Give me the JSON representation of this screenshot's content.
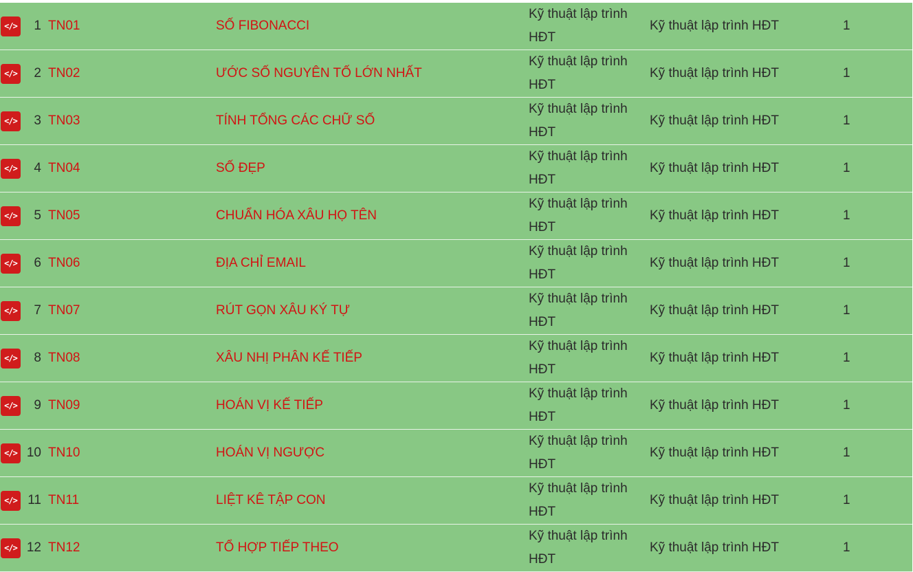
{
  "icon_name": "code-icon",
  "icon_glyph": "</>",
  "accent_color": "#d11414",
  "row_color": "#88c884",
  "rows": [
    {
      "num": "1",
      "code": "TN01",
      "title": "SỐ FIBONACCI",
      "group": "Kỹ thuật lập trình HĐT",
      "subject": "Kỹ thuật lập trình HĐT",
      "level": "1"
    },
    {
      "num": "2",
      "code": "TN02",
      "title": "ƯỚC SỐ NGUYÊN TỐ LỚN NHẤT",
      "group": "Kỹ thuật lập trình HĐT",
      "subject": "Kỹ thuật lập trình HĐT",
      "level": "1"
    },
    {
      "num": "3",
      "code": "TN03",
      "title": "TÍNH TỔNG CÁC CHỮ SỐ",
      "group": "Kỹ thuật lập trình HĐT",
      "subject": "Kỹ thuật lập trình HĐT",
      "level": "1"
    },
    {
      "num": "4",
      "code": "TN04",
      "title": "SỐ ĐẸP",
      "group": "Kỹ thuật lập trình HĐT",
      "subject": "Kỹ thuật lập trình HĐT",
      "level": "1"
    },
    {
      "num": "5",
      "code": "TN05",
      "title": "CHUẨN HÓA XÂU HỌ TÊN",
      "group": "Kỹ thuật lập trình HĐT",
      "subject": "Kỹ thuật lập trình HĐT",
      "level": "1"
    },
    {
      "num": "6",
      "code": "TN06",
      "title": "ĐỊA CHỈ EMAIL",
      "group": "Kỹ thuật lập trình HĐT",
      "subject": "Kỹ thuật lập trình HĐT",
      "level": "1"
    },
    {
      "num": "7",
      "code": "TN07",
      "title": "RÚT GỌN XÂU KÝ TỰ",
      "group": "Kỹ thuật lập trình HĐT",
      "subject": "Kỹ thuật lập trình HĐT",
      "level": "1"
    },
    {
      "num": "8",
      "code": "TN08",
      "title": "XÂU NHỊ PHÂN KẾ TIẾP",
      "group": "Kỹ thuật lập trình HĐT",
      "subject": "Kỹ thuật lập trình HĐT",
      "level": "1"
    },
    {
      "num": "9",
      "code": "TN09",
      "title": "HOÁN VỊ KẾ TIẾP",
      "group": "Kỹ thuật lập trình HĐT",
      "subject": "Kỹ thuật lập trình HĐT",
      "level": "1"
    },
    {
      "num": "10",
      "code": "TN10",
      "title": "HOÁN VỊ NGƯỢC",
      "group": "Kỹ thuật lập trình HĐT",
      "subject": "Kỹ thuật lập trình HĐT",
      "level": "1"
    },
    {
      "num": "11",
      "code": "TN11",
      "title": "LIỆT KÊ TẬP CON",
      "group": "Kỹ thuật lập trình HĐT",
      "subject": "Kỹ thuật lập trình HĐT",
      "level": "1"
    },
    {
      "num": "12",
      "code": "TN12",
      "title": "TỔ HỢP TIẾP THEO",
      "group": "Kỹ thuật lập trình HĐT",
      "subject": "Kỹ thuật lập trình HĐT",
      "level": "1"
    }
  ]
}
